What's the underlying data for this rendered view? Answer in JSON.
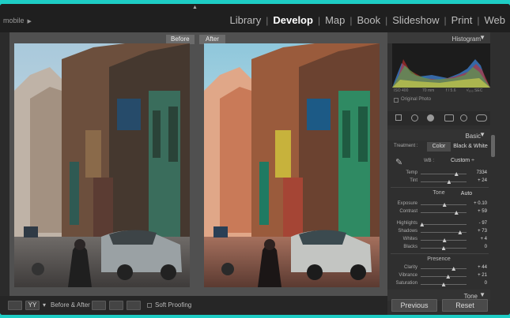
{
  "app": {
    "identity": "mobile",
    "modules": [
      "Library",
      "Develop",
      "Map",
      "Book",
      "Slideshow",
      "Print",
      "Web"
    ],
    "active_module": "Develop"
  },
  "viewer": {
    "before_label": "Before",
    "after_label": "After"
  },
  "toolbar": {
    "before_after_label": "Before & After :",
    "soft_proofing_label": "Soft Proofing"
  },
  "histogram": {
    "title": "Histogram",
    "iso": "ISO 400",
    "focal": "70 mm",
    "aperture": "f / 5.6",
    "shutter": "¹⁄₅₀₀ SEC",
    "original_photo_label": "Original Photo"
  },
  "basic": {
    "title": "Basic",
    "treatment_label": "Treatment :",
    "treatment_color": "Color",
    "treatment_bw": "Black & White",
    "wb_label": "WB :",
    "wb_value": "Custom",
    "tone_label": "Tone",
    "auto_label": "Auto",
    "presence_label": "Presence",
    "next_panel": "Tone Curve",
    "sliders": [
      {
        "label": "Temp",
        "value": "7334",
        "pos": 0.78
      },
      {
        "label": "Tint",
        "value": "+ 24",
        "pos": 0.62
      },
      {
        "label": "Exposure",
        "value": "+ 0.10",
        "pos": 0.52
      },
      {
        "label": "Contrast",
        "value": "+ 59",
        "pos": 0.78
      },
      {
        "label": "Highlights",
        "value": "- 97",
        "pos": 0.03
      },
      {
        "label": "Shadows",
        "value": "+ 73",
        "pos": 0.86
      },
      {
        "label": "Whites",
        "value": "+ 4",
        "pos": 0.52
      },
      {
        "label": "Blacks",
        "value": "0",
        "pos": 0.5
      },
      {
        "label": "Clarity",
        "value": "+ 44",
        "pos": 0.72
      },
      {
        "label": "Vibrance",
        "value": "+ 21",
        "pos": 0.6
      },
      {
        "label": "Saturation",
        "value": "0",
        "pos": 0.5
      }
    ]
  },
  "buttons": {
    "previous": "Previous",
    "reset": "Reset"
  },
  "colors": {
    "accent_border": "#1ecdc5",
    "panel_bg": "#2f2f2f",
    "viewer_bg": "#505050"
  }
}
